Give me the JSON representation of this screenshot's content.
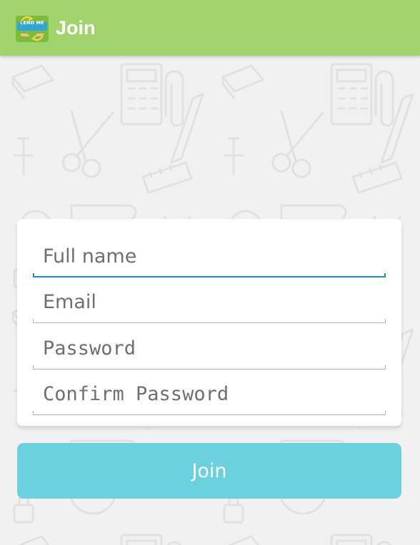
{
  "appbar": {
    "title": "Join",
    "logo_text": "LEND ME",
    "background": "#a2d46d"
  },
  "form": {
    "full_name": {
      "placeholder": "Full name",
      "value": "",
      "focused": true
    },
    "email": {
      "placeholder": "Email",
      "value": ""
    },
    "password": {
      "placeholder": "Password",
      "value": ""
    },
    "confirm_password": {
      "placeholder": "Confirm Password",
      "value": ""
    }
  },
  "join_button": {
    "label": "Join",
    "color": "#6bd1df"
  },
  "colors": {
    "focus_underline": "#1b8ed0",
    "underline": "#b5b5b5",
    "background": "#f1f1f1"
  },
  "icons": [
    "lend-me-logo-icon",
    "doodle-background-pattern"
  ]
}
